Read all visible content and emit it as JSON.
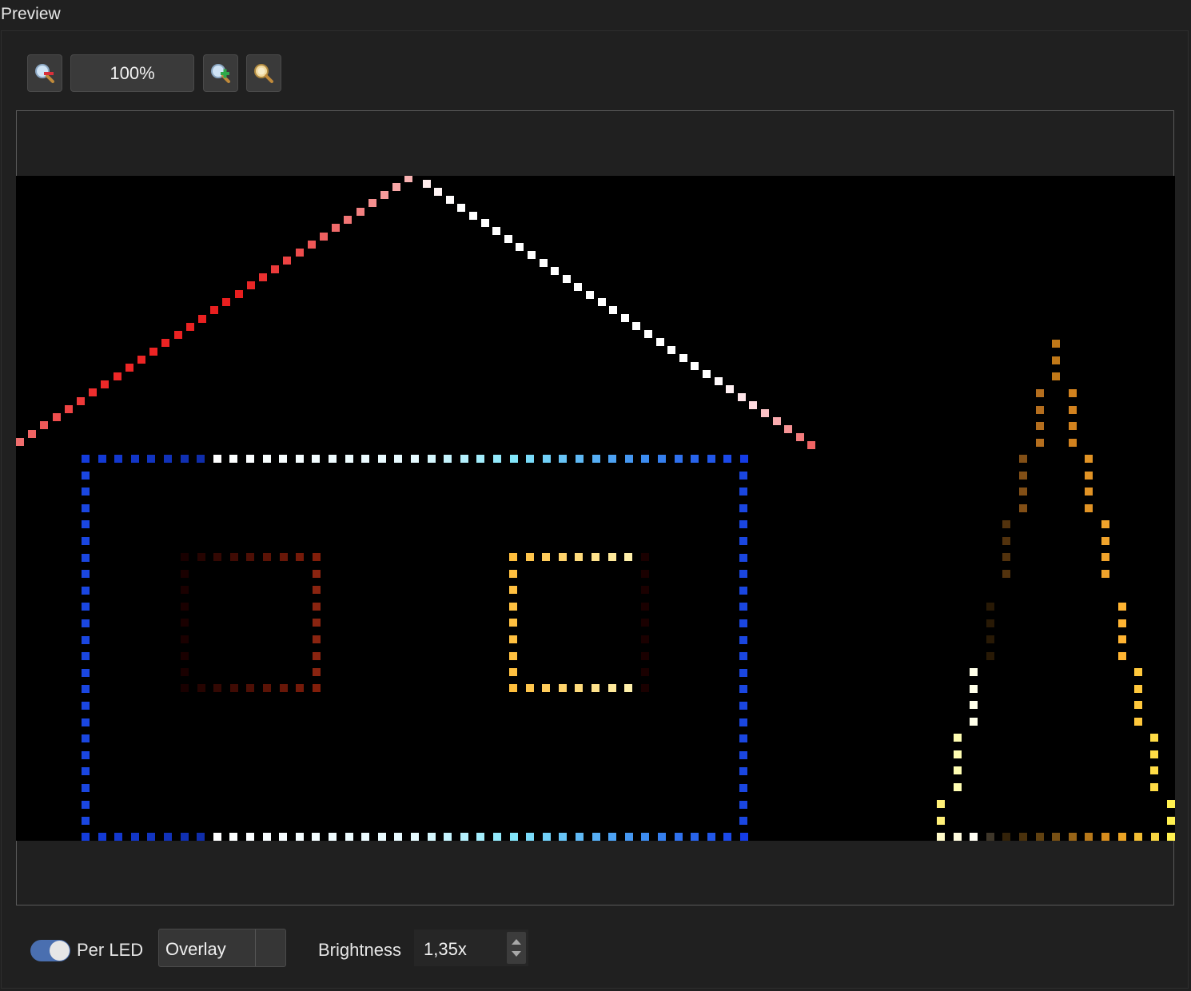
{
  "panel": {
    "title": "Preview"
  },
  "toolbar": {
    "zoom_out_icon": "zoom-out-icon",
    "zoom_value": "100%",
    "zoom_in_icon": "zoom-in-icon",
    "zoom_fit_icon": "zoom-fit-icon"
  },
  "bottom": {
    "per_led_label": "Per LED",
    "per_led_on": true,
    "mode_value": "Overlay",
    "brightness_label": "Brightness",
    "brightness_value": "1,35x"
  },
  "colors": {
    "background": "#202020",
    "canvas": "#000000",
    "toggle_on": "#4a6fb0"
  }
}
